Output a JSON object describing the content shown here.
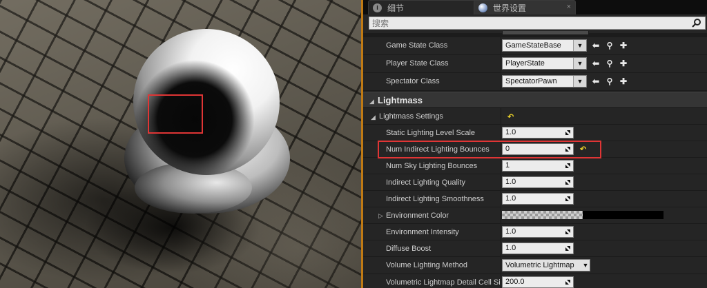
{
  "tabs": [
    {
      "label": "细节",
      "icon": "info-icon",
      "close": "×"
    },
    {
      "label": "世界设置",
      "icon": "globe-icon",
      "close": "×"
    }
  ],
  "search": {
    "placeholder": "搜索"
  },
  "class_rows": [
    {
      "label": "Game State Class",
      "value": "GameStateBase"
    },
    {
      "label": "Player State Class",
      "value": "PlayerState"
    },
    {
      "label": "Spectator Class",
      "value": "SpectatorPawn"
    }
  ],
  "category": {
    "label": "Lightmass"
  },
  "subcategory": {
    "label": "Lightmass Settings",
    "reset": "↶"
  },
  "properties": [
    {
      "label": "Static Lighting Level Scale",
      "value": "1.0"
    },
    {
      "label": "Num Indirect Lighting Bounces",
      "value": "0",
      "reset": "↶"
    },
    {
      "label": "Num Sky Lighting Bounces",
      "value": "1"
    },
    {
      "label": "Indirect Lighting Quality",
      "value": "1.0"
    },
    {
      "label": "Indirect Lighting Smoothness",
      "value": "1.0"
    },
    {
      "label": "Environment Color",
      "value": ""
    },
    {
      "label": "Environment Intensity",
      "value": "1.0"
    },
    {
      "label": "Diffuse Boost",
      "value": "1.0"
    },
    {
      "label": "Volume Lighting Method",
      "value": "Volumetric Lightmap"
    },
    {
      "label": "Volumetric Lightmap Detail Cell Size",
      "value": "200.0"
    }
  ],
  "colors": {
    "accent": "#c07a14",
    "highlight": "#e03535",
    "reset": "#e8cf2a"
  }
}
